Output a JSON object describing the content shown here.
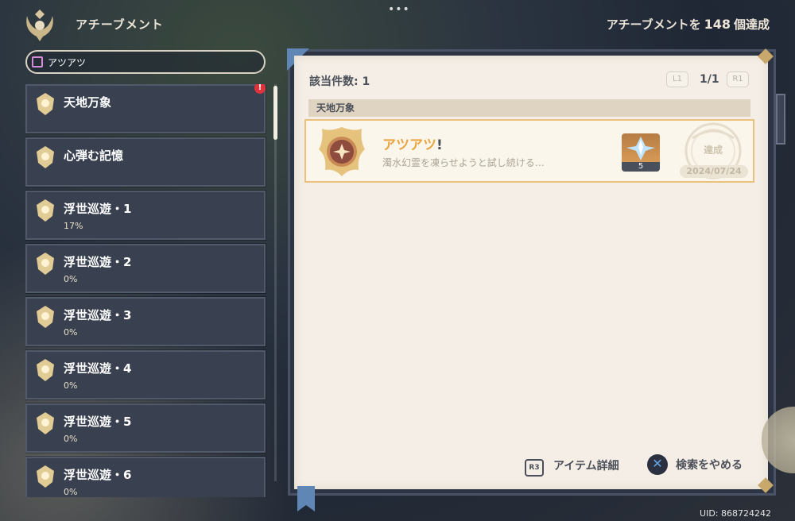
{
  "header": {
    "title": "アチーブメント",
    "count_prefix": "アチーブメントを",
    "count_value": "148",
    "count_suffix": "個達成"
  },
  "search": {
    "value": "アツアツ"
  },
  "categories": [
    {
      "name": "天地万象",
      "progress": "",
      "alert": "!"
    },
    {
      "name": "心弾む記憶",
      "progress": ""
    },
    {
      "name": "浮世巡遊・1",
      "progress": "17%"
    },
    {
      "name": "浮世巡遊・2",
      "progress": "0%"
    },
    {
      "name": "浮世巡遊・3",
      "progress": "0%"
    },
    {
      "name": "浮世巡遊・4",
      "progress": "0%"
    },
    {
      "name": "浮世巡遊・5",
      "progress": "0%"
    },
    {
      "name": "浮世巡遊・6",
      "progress": "0%"
    }
  ],
  "results": {
    "count_label": "該当件数: 1",
    "prev_button": "L1",
    "next_button": "R1",
    "page": "1/1",
    "section": "天地万象"
  },
  "achievement": {
    "title": "アツアツ",
    "title_mark": "!",
    "description": "濁水幻霊を凍らせようと試し続ける…",
    "reward_count": "5",
    "status": "達成",
    "date": "2024/07/24"
  },
  "footer": {
    "detail_key": "R3",
    "detail_label": "アイテム詳細",
    "cancel_key": "✕",
    "cancel_label": "検索をやめる"
  },
  "uid": "UID: 868724242",
  "colors": {
    "accent": "#e9a640",
    "panel": "#f4eee6",
    "category_bg": "#39404f",
    "alert": "#e0323a"
  }
}
